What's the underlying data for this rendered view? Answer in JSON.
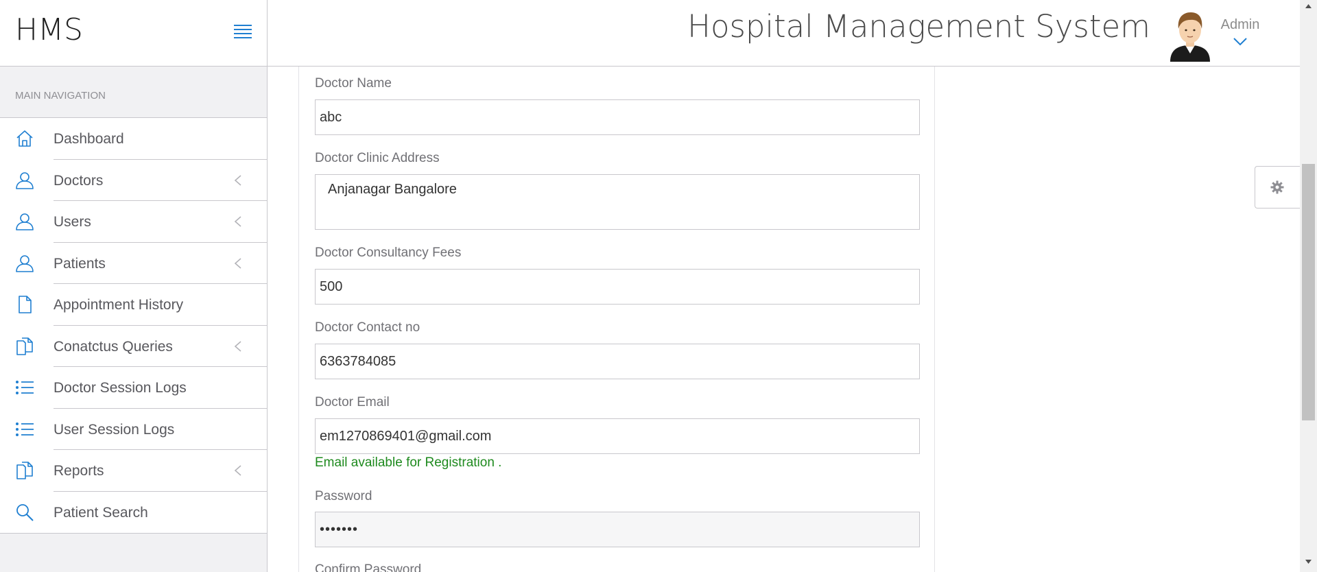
{
  "brand": {
    "logo_text": "HMS",
    "menu_icon": "hamburger-icon"
  },
  "header": {
    "title": "Hospital Management System",
    "user_name": "Admin",
    "accent_color": "#1f7fd1"
  },
  "sidebar": {
    "heading": "MAIN NAVIGATION",
    "items": [
      {
        "label": "Dashboard",
        "icon": "home-icon",
        "has_submenu": false
      },
      {
        "label": "Doctors",
        "icon": "user-icon",
        "has_submenu": true
      },
      {
        "label": "Users",
        "icon": "user-icon",
        "has_submenu": true
      },
      {
        "label": "Patients",
        "icon": "user-icon",
        "has_submenu": true
      },
      {
        "label": "Appointment History",
        "icon": "file-icon",
        "has_submenu": false
      },
      {
        "label": "Conatctus Queries",
        "icon": "files-icon",
        "has_submenu": true
      },
      {
        "label": "Doctor Session Logs",
        "icon": "list-icon",
        "has_submenu": false
      },
      {
        "label": "User Session Logs",
        "icon": "list-icon",
        "has_submenu": false
      },
      {
        "label": "Reports",
        "icon": "files-icon",
        "has_submenu": true
      },
      {
        "label": "Patient Search",
        "icon": "search-icon",
        "has_submenu": false
      }
    ]
  },
  "form": {
    "doctor_name": {
      "label": "Doctor Name",
      "value": "abc"
    },
    "clinic_address": {
      "label": "Doctor Clinic Address",
      "value": "Anjanagar Bangalore"
    },
    "fees": {
      "label": "Doctor Consultancy Fees",
      "value": "500"
    },
    "contact": {
      "label": "Doctor Contact no",
      "value": "6363784085"
    },
    "email": {
      "label": "Doctor Email",
      "value": "em1270869401@gmail.com",
      "status": "Email available for Registration ."
    },
    "password": {
      "label": "Password",
      "value": "•••••••"
    },
    "confirm_password": {
      "label": "Confirm Password"
    }
  },
  "settings": {
    "icon": "gear-icon"
  }
}
